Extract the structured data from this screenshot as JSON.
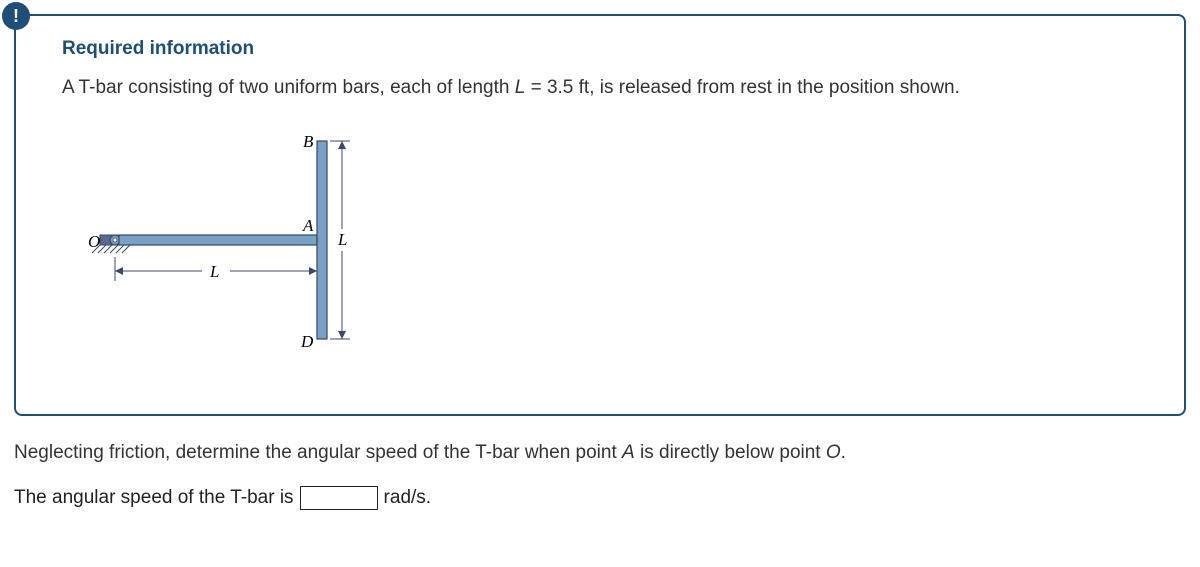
{
  "badge": "!",
  "required_title": "Required information",
  "problem_text_pre": "A T-bar consisting of two uniform bars, each of length ",
  "problem_var": "L",
  "problem_text_mid": " = 3.5 ft, is released from rest in the position shown.",
  "diagram": {
    "label_O": "O",
    "label_A": "A",
    "label_B": "B",
    "label_D": "D",
    "label_L_h": "L",
    "label_L_v": "L"
  },
  "question_pre": "Neglecting friction, determine the angular speed of the T-bar when point ",
  "question_A": "A",
  "question_mid": " is directly below point ",
  "question_O": "O",
  "question_end": ".",
  "answer_pre": "The angular speed of the T-bar is",
  "answer_value": "",
  "answer_unit": "rad/s."
}
